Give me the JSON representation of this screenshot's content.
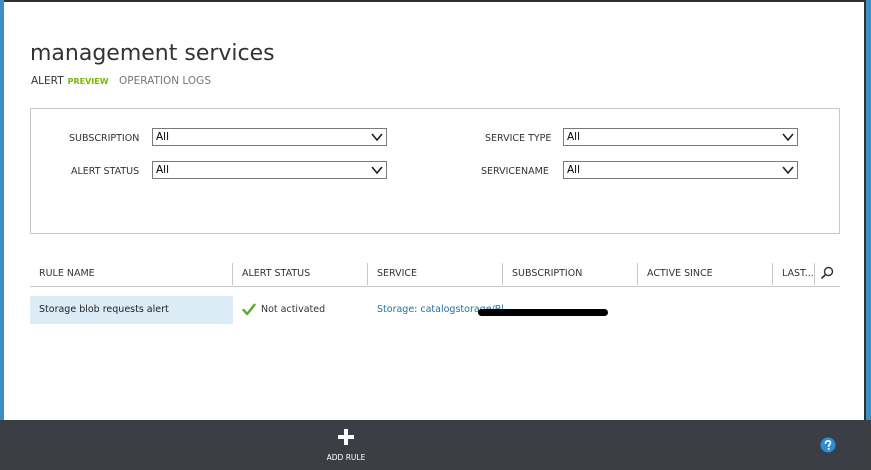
{
  "page": {
    "title": "management services"
  },
  "tabs": {
    "alert_label": "ALERT",
    "alert_badge": "PREVIEW",
    "operation_logs_label": "OPERATION LOGS"
  },
  "filters": {
    "subscription_label": "SUBSCRIPTION",
    "subscription_value": "All",
    "alert_status_label": "ALERT STATUS",
    "alert_status_value": "All",
    "service_type_label": "SERVICE TYPE",
    "service_type_value": "All",
    "servicename_label": "SERVICENAME",
    "servicename_value": "All"
  },
  "table": {
    "columns": [
      "RULE NAME",
      "ALERT STATUS",
      "SERVICE",
      "SUBSCRIPTION",
      "ACTIVE SINCE",
      "LAST..."
    ],
    "rows": [
      {
        "rule_name": "Storage blob requests alert",
        "alert_status": "Not activated",
        "service": "Storage: catalogstorage/Bl..."
      }
    ]
  },
  "toolbar": {
    "add_rule_label": "ADD RULE"
  },
  "icons": {
    "chevron": "chevron-down-icon",
    "search": "search-icon",
    "check": "check-icon",
    "plus": "plus-icon",
    "help": "help-icon"
  },
  "colors": {
    "accent_blue": "#3e8ec4",
    "preview_green": "#7ab800",
    "selected_row": "#dcecf6",
    "link": "#1e6fa8",
    "bottom_bar": "#3b3e44",
    "help_blue": "#2b8fd6",
    "check_green": "#5eaa2f"
  }
}
